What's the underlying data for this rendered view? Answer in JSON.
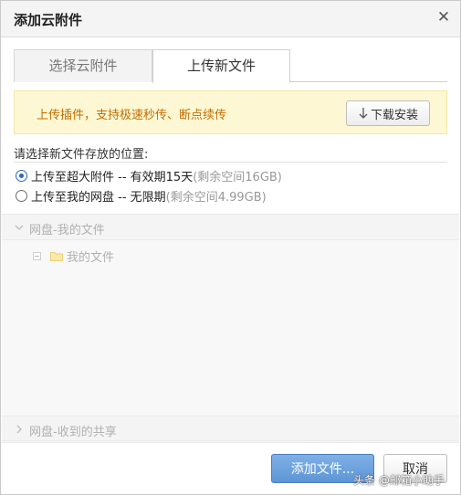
{
  "dialog": {
    "title": "添加云附件"
  },
  "tabs": [
    {
      "label": "选择云附件",
      "active": false
    },
    {
      "label": "上传新文件",
      "active": true
    }
  ],
  "notice": {
    "text": "上传插件，支持极速秒传、断点续传",
    "download_button": "下载安装"
  },
  "location": {
    "label": "请选择新文件存放的位置:",
    "options": [
      {
        "main": "上传至超大附件 -- 有效期15天",
        "sub": "(剩余空间16GB)",
        "checked": true
      },
      {
        "main": "上传至我的网盘 -- 无限期",
        "sub": "(剩余空间4.99GB)",
        "checked": false
      }
    ]
  },
  "tree": {
    "my_files_section": "网盘-我的文件",
    "my_files_folder": "我的文件",
    "shared_section": "网盘-收到的共享"
  },
  "buttons": {
    "add_files": "添加文件...",
    "cancel": "取消"
  },
  "watermark": "头条 @邮箱小助手",
  "colors": {
    "accent": "#5c95d6",
    "notice_bg": "#fdf8d3",
    "notice_text": "#c56b00",
    "radio_checked": "#2d68b7"
  }
}
